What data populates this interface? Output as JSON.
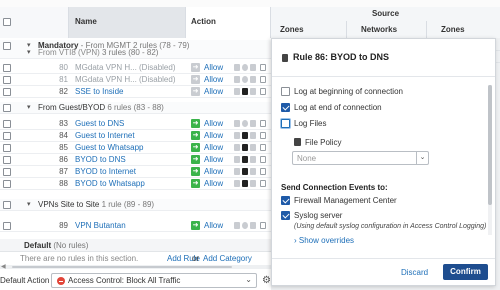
{
  "header": {
    "name_col": "Name",
    "action_col": "Action",
    "source_group": "Source",
    "source_zones": "Zones",
    "source_networks": "Networks",
    "dest_zones": "Zones"
  },
  "groups": [
    {
      "title": "Mandatory",
      "subtitle": " - From MGMT 2 rules (78 - 79)"
    },
    {
      "title": "From VTI8 (VPN)",
      "subtitle": " 3 rules (80 - 82)"
    },
    {
      "title": "From Guest/BYOD",
      "subtitle": " 6 rules (83 - 88)"
    },
    {
      "title": "VPNs Site to Site",
      "subtitle": " 1 rule (89 - 89)"
    }
  ],
  "rules": [
    {
      "num": "80",
      "name": "MGdata VPN H... (Disabled)",
      "action": "Allow"
    },
    {
      "num": "81",
      "name": "MGdata VPN H... (Disabled)",
      "action": "Allow"
    },
    {
      "num": "82",
      "name": "SSE to Inside",
      "action": "Allow"
    },
    {
      "num": "83",
      "name": "Guest to DNS",
      "action": "Allow"
    },
    {
      "num": "84",
      "name": "Guest to Internet",
      "action": "Allow"
    },
    {
      "num": "85",
      "name": "Guest to Whatsapp",
      "action": "Allow"
    },
    {
      "num": "86",
      "name": "BYOD to DNS",
      "action": "Allow"
    },
    {
      "num": "87",
      "name": "BYOD to Internet",
      "action": "Allow"
    },
    {
      "num": "88",
      "name": "BYOD to Whatsapp",
      "action": "Allow"
    },
    {
      "num": "89",
      "name": "VPN Butantan",
      "action": "Allow"
    }
  ],
  "default_section": {
    "label": "Default",
    "count": " (No rules)"
  },
  "empty_section": {
    "text": "There are no rules in this section.",
    "add_rule": "Add Rule",
    "or": "or",
    "add_category": "Add Category"
  },
  "bottom": {
    "label": "Default Action",
    "value": "Access Control: Block All Traffic",
    "dropdown_icon": "chevron-down-icon",
    "settings_icon": "gear-icon"
  },
  "modal": {
    "title": "Rule 86: BYOD to DNS",
    "log_begin": "Log at beginning of connection",
    "log_end": "Log at end of connection",
    "log_files": "Log Files",
    "file_policy_label": "File Policy",
    "file_policy_value": "None",
    "send_events_label": "Send Connection Events to:",
    "fmc": "Firewall Management Center",
    "syslog": "Syslog server",
    "syslog_note": "(Using default syslog configuration in Access Control Logging)",
    "show_overrides": "Show overrides",
    "discard": "Discard",
    "confirm": "Confirm",
    "states": {
      "log_begin": false,
      "log_end": true,
      "log_files": false,
      "fmc": true,
      "syslog": true
    }
  },
  "colors": {
    "accent": "#1e6fb8",
    "confirm_bg": "#1e4d8f",
    "allow_green": "#3ab34a",
    "block_red": "#e2463a"
  }
}
